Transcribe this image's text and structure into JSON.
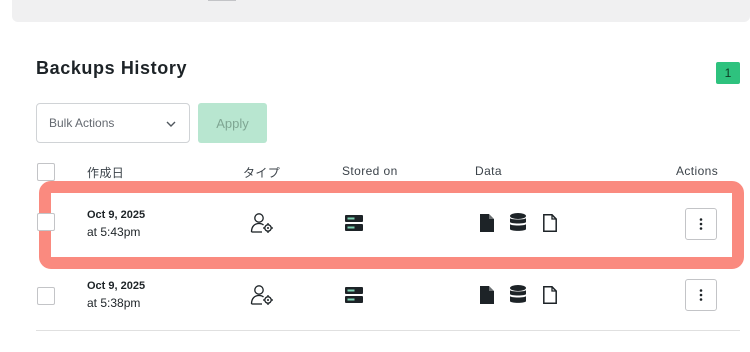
{
  "section_title": "Backups History",
  "count_badge": "1",
  "bulk_actions": {
    "selected": "Bulk Actions"
  },
  "apply_label": "Apply",
  "columns": {
    "created": "作成日",
    "type": "タイプ",
    "stored_on": "Stored on",
    "data": "Data",
    "actions": "Actions"
  },
  "rows": [
    {
      "date": "Oct 9, 2025",
      "time": "at 5:43pm"
    },
    {
      "date": "Oct 9, 2025",
      "time": "at 5:38pm"
    }
  ],
  "icons": {
    "type": "user-gear-icon",
    "stored_on": "server-icon",
    "data": [
      "file-icon",
      "database-icon",
      "document-outline-icon"
    ],
    "actions": "more-vertical-icon"
  },
  "colors": {
    "accent_green": "#2ec27e",
    "apply_disabled": "#b8e6d0",
    "highlight": "#fa8a7f",
    "server_light": "#7fd3b4"
  }
}
